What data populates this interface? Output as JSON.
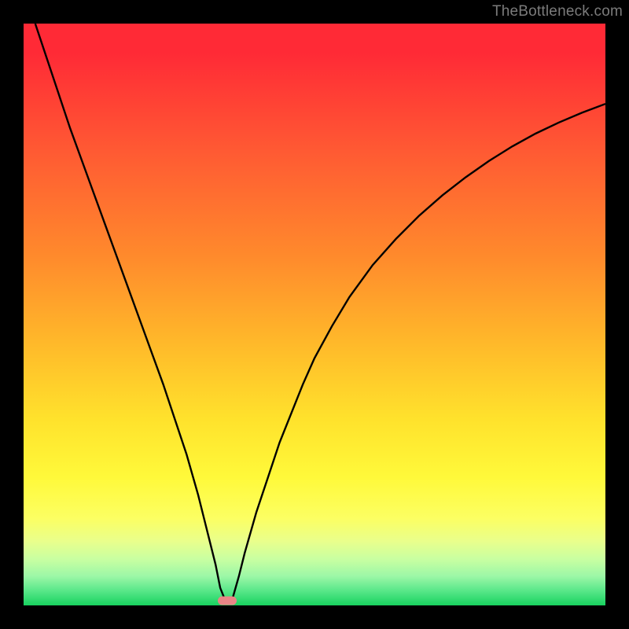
{
  "watermark": "TheBottleneck.com",
  "colors": {
    "background": "#000000",
    "gradient_top": "#ff2a36",
    "gradient_bottom": "#18d25f",
    "curve": "#000000",
    "marker": "#e98586",
    "watermark_text": "#7b7b7b"
  },
  "chart_data": {
    "type": "line",
    "title": "",
    "xlabel": "",
    "ylabel": "",
    "xlim": [
      0,
      100
    ],
    "ylim": [
      0,
      100
    ],
    "curve": {
      "x": [
        2,
        4,
        6,
        8,
        10,
        12,
        14,
        16,
        18,
        20,
        22,
        24,
        26,
        28,
        30,
        31,
        32,
        33,
        33.8,
        34.6,
        35.4,
        36,
        37,
        38,
        40,
        42,
        44,
        46,
        48,
        50,
        53,
        56,
        60,
        64,
        68,
        72,
        76,
        80,
        84,
        88,
        92,
        96,
        100
      ],
      "y": [
        100,
        94,
        88,
        82,
        76.5,
        71,
        65.5,
        60,
        54.5,
        49,
        43.5,
        38,
        32,
        26,
        19,
        15,
        11,
        7,
        3,
        1,
        0.5,
        1.5,
        5,
        9,
        16,
        22,
        28,
        33,
        38,
        42.5,
        48,
        53,
        58.5,
        63,
        67,
        70.5,
        73.6,
        76.4,
        78.9,
        81.1,
        83,
        84.7,
        86.2
      ]
    },
    "marker": {
      "x": 35,
      "y": 0.8
    },
    "annotations": []
  }
}
